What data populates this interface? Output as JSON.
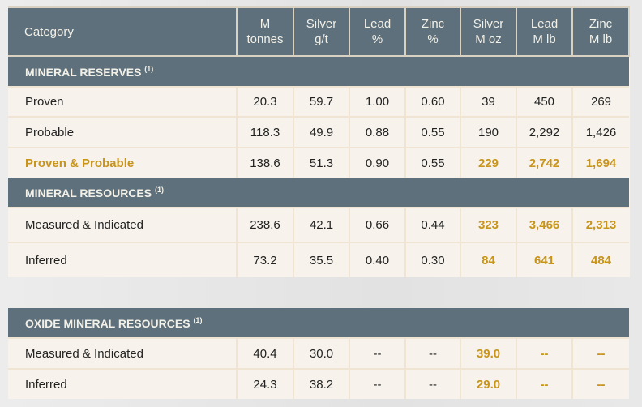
{
  "headers": [
    {
      "l1": "Category",
      "l2": ""
    },
    {
      "l1": "M",
      "l2": "tonnes"
    },
    {
      "l1": "Silver",
      "l2": "g/t"
    },
    {
      "l1": "Lead",
      "l2": "%"
    },
    {
      "l1": "Zinc",
      "l2": "%"
    },
    {
      "l1": "Silver",
      "l2": "M oz"
    },
    {
      "l1": "Lead",
      "l2": "M lb"
    },
    {
      "l1": "Zinc",
      "l2": "M lb"
    }
  ],
  "colors": {
    "header_bg": "#5d707b",
    "gold": "#c8941a",
    "row_bg": "#f7f3ec"
  },
  "tables": [
    {
      "sections": [
        {
          "title": "MINERAL RESERVES",
          "note": "(1)",
          "rows": [
            {
              "category": "Proven",
              "values": [
                "20.3",
                "59.7",
                "1.00",
                "0.60",
                "39",
                "450",
                "269"
              ],
              "highlight_row": false,
              "gold_cols": [],
              "h": 37
            },
            {
              "category": "Probable",
              "values": [
                "118.3",
                "49.9",
                "0.88",
                "0.55",
                "190",
                "2,292",
                "1,426"
              ],
              "highlight_row": false,
              "gold_cols": [],
              "h": 38
            },
            {
              "category": "Proven & Probable",
              "values": [
                "138.6",
                "51.3",
                "0.90",
                "0.55",
                "229",
                "2,742",
                "1,694"
              ],
              "highlight_row": true,
              "gold_cols": [
                4,
                5,
                6
              ],
              "h": 37
            }
          ]
        },
        {
          "title": "MINERAL RESOURCES",
          "note": "(1)",
          "rows": [
            {
              "category": "Measured & Indicated",
              "values": [
                "238.6",
                "42.1",
                "0.66",
                "0.44",
                "323",
                "3,466",
                "2,313"
              ],
              "highlight_row": false,
              "gold_cols": [
                4,
                5,
                6
              ],
              "h": 43
            },
            {
              "category": "Inferred",
              "values": [
                "73.2",
                "35.5",
                "0.40",
                "0.30",
                "84",
                "641",
                "484"
              ],
              "highlight_row": false,
              "gold_cols": [
                4,
                5,
                6
              ],
              "h": 43
            }
          ]
        }
      ]
    },
    {
      "sections": [
        {
          "title": "OXIDE MINERAL RESOURCES",
          "note": "(1)",
          "rows": [
            {
              "category": "Measured & Indicated",
              "values": [
                "40.4",
                "30.0",
                "--",
                "--",
                "39.0",
                "--",
                "--"
              ],
              "highlight_row": false,
              "gold_cols": [
                4,
                5,
                6
              ],
              "h": 38
            },
            {
              "category": "Inferred",
              "values": [
                "24.3",
                "38.2",
                "--",
                "--",
                "29.0",
                "--",
                "--"
              ],
              "highlight_row": false,
              "gold_cols": [
                4,
                5,
                6
              ],
              "h": 37
            }
          ]
        }
      ]
    }
  ]
}
